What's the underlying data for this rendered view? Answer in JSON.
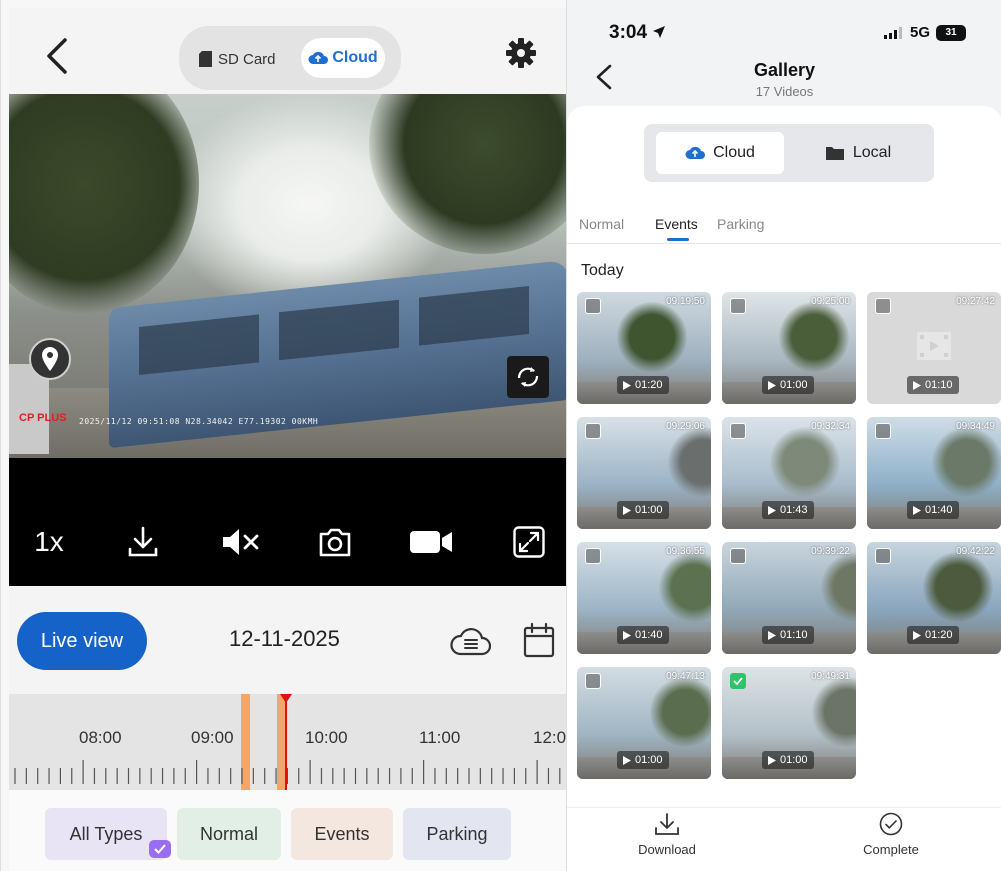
{
  "left": {
    "source_tabs": {
      "sd_card": "SD Card",
      "cloud": "Cloud",
      "selected": "Cloud"
    },
    "video_overlay": {
      "brand": "CP PLUS",
      "stamp": "2025/11/12 09:51:08 N28.34042 E77.19302 00KMH"
    },
    "controls": {
      "speed": "1x"
    },
    "live_view_label": "Live view",
    "date": "12-11-2025",
    "timeline": {
      "labels": [
        "08:00",
        "09:00",
        "10:00",
        "11:00",
        "12:0"
      ]
    },
    "filters": [
      "All Types",
      "Normal",
      "Events",
      "Parking"
    ],
    "colors": {
      "accent": "#1563c9",
      "event_segment": "#f2a66a",
      "cursor": "#dd1111"
    }
  },
  "right": {
    "status_bar": {
      "time": "3:04",
      "network": "5G",
      "battery": "31"
    },
    "header": {
      "title": "Gallery",
      "subtitle": "17 Videos"
    },
    "source_tabs": {
      "cloud": "Cloud",
      "local": "Local",
      "selected": "Cloud"
    },
    "type_tabs": [
      "Normal",
      "Events",
      "Parking"
    ],
    "active_type_tab": "Events",
    "section_title": "Today",
    "videos": [
      {
        "time": "09:19:50",
        "duration": "01:20",
        "selected": false
      },
      {
        "time": "09:25:00",
        "duration": "01:00",
        "selected": false
      },
      {
        "time": "09:27:42",
        "duration": "01:10",
        "selected": false
      },
      {
        "time": "09:29:06",
        "duration": "01:00",
        "selected": false
      },
      {
        "time": "09:32:34",
        "duration": "01:43",
        "selected": false
      },
      {
        "time": "09:34:49",
        "duration": "01:40",
        "selected": false
      },
      {
        "time": "09:36:55",
        "duration": "01:40",
        "selected": false
      },
      {
        "time": "09:39:22",
        "duration": "01:10",
        "selected": false
      },
      {
        "time": "09:42:22",
        "duration": "01:20",
        "selected": false
      },
      {
        "time": "09:47:13",
        "duration": "01:00",
        "selected": false
      },
      {
        "time": "09:49:31",
        "duration": "01:00",
        "selected": true
      }
    ],
    "bottom_actions": {
      "download": "Download",
      "complete": "Complete"
    },
    "colors": {
      "accent": "#1f6fd1",
      "selected_check": "#2ec46b"
    }
  }
}
